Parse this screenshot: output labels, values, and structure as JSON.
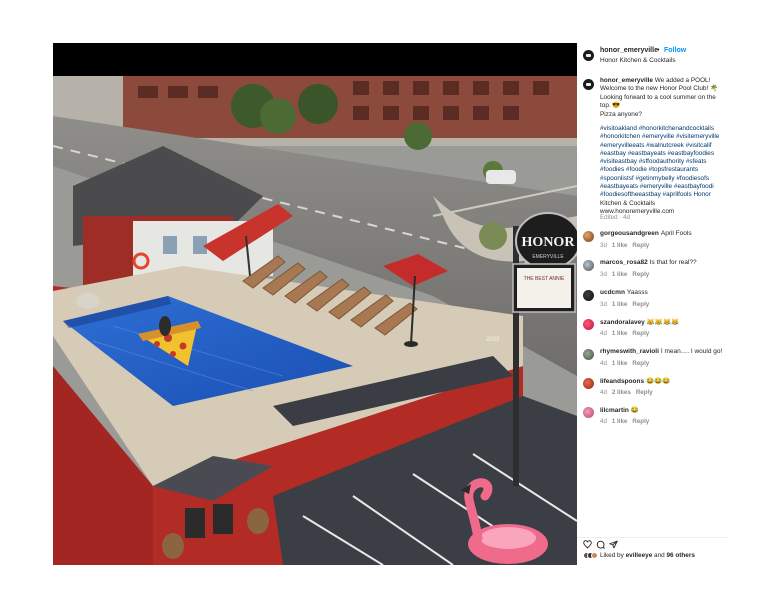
{
  "post": {
    "username": "honor_emeryville",
    "separator": "•",
    "follow_label": "Follow",
    "location": "Honor Kitchen & Cocktails"
  },
  "caption": {
    "username": "honor_emeryville",
    "text_lines": [
      " We added a POOL!",
      "Welcome to the new Honor Pool Club! 🌴",
      "Looking forward to a cool summer on the",
      "top. 😎",
      "Pizza anyone?"
    ],
    "tag_lines": [
      "#visitoakland #honorkitchenandcocktails",
      "#honorkitchen #emeryville #visitemeryville",
      "#emeryvilleeats #walnutcreek #visitcalif",
      "#eastbay #eastbayeats #eastbayfoodies",
      "#visiteastbay #sffoodauthority #sfeats",
      "#foodies #foodie #topsfrestaurants",
      "#spoonlistsf #getinmybelly #foodiesofs",
      "#eastbayeats #emeryville #eastbayfoodi",
      "#foodiesoftheeastbay #aprilfools Honor",
      "Kitchen & Cocktails",
      "www.honoremeryville.com"
    ],
    "meta": "Edited · 4d"
  },
  "comments": [
    {
      "username": "gorgeousandgreen",
      "text": "April Fools",
      "time": "3d",
      "likes": "1 like",
      "reply": "Reply"
    },
    {
      "username": "marcos_rosa82",
      "text": "Is that for real??",
      "time": "3d",
      "likes": "1 like",
      "reply": "Reply"
    },
    {
      "username": "ucdcmn",
      "text": "Yaasss",
      "time": "3d",
      "likes": "1 like",
      "reply": "Reply"
    },
    {
      "username": "szandoralavey",
      "text": "😹😹😹😹",
      "time": "4d",
      "likes": "1 like",
      "reply": "Reply"
    },
    {
      "username": "rhymeswith_ravioli",
      "text": "I mean…. I would go!",
      "time": "4d",
      "likes": "1 like",
      "reply": "Reply"
    },
    {
      "username": "lifeandspoons",
      "text": "😂😂😂",
      "time": "4d",
      "likes": "2 likes",
      "reply": "Reply"
    },
    {
      "username": "lilcmartin",
      "text": "😂",
      "time": "4d",
      "likes": "1 like",
      "reply": "Reply"
    }
  ],
  "likes": {
    "prefix": "Liked by",
    "user": "evilleeye",
    "joiner": "and",
    "count": "96 others"
  },
  "icons": [
    "heart-icon",
    "comment-icon",
    "share-icon"
  ],
  "photo": {
    "sign_text": "HONOR",
    "sign_small": "EMERYVILLE",
    "billboard_text": "THE BEST ANNIE",
    "building_number": "2033"
  }
}
